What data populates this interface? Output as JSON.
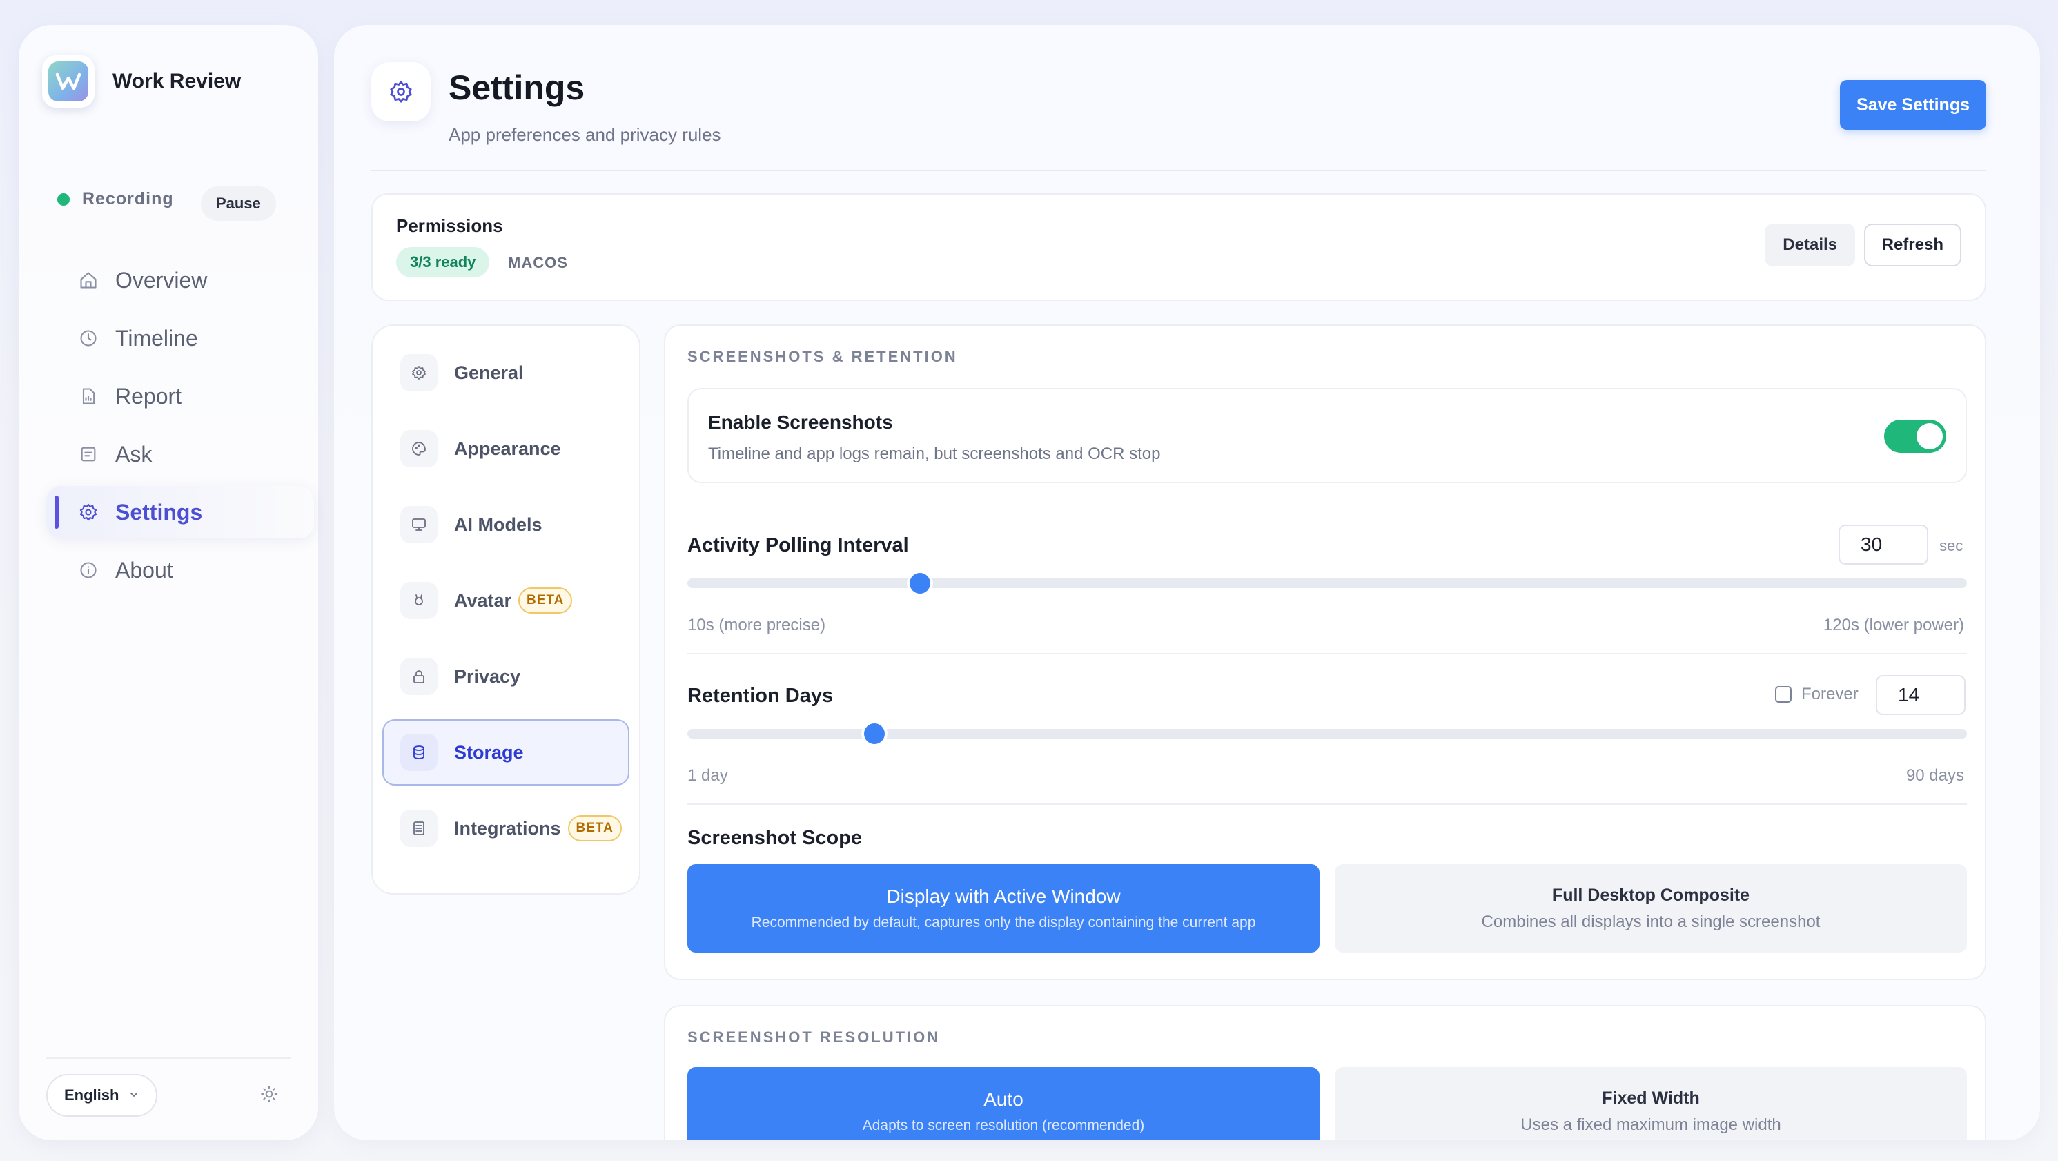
{
  "app": {
    "name": "Work Review"
  },
  "status": {
    "recording_label": "Recording",
    "pause_label": "Pause",
    "recording_color": "#1fb87a"
  },
  "nav": {
    "items": [
      {
        "label": "Overview",
        "icon": "home-icon"
      },
      {
        "label": "Timeline",
        "icon": "clock-icon"
      },
      {
        "label": "Report",
        "icon": "report-icon"
      },
      {
        "label": "Ask",
        "icon": "ask-icon"
      },
      {
        "label": "Settings",
        "icon": "gear-icon",
        "active": true
      },
      {
        "label": "About",
        "icon": "info-icon"
      }
    ]
  },
  "footer": {
    "language": "English"
  },
  "page": {
    "title": "Settings",
    "subtitle": "App preferences and privacy rules",
    "save_label": "Save Settings"
  },
  "permissions": {
    "title": "Permissions",
    "badge": "3/3 ready",
    "os": "MACOS",
    "details_label": "Details",
    "refresh_label": "Refresh"
  },
  "subnav": {
    "items": [
      {
        "label": "General",
        "icon": "gear-icon"
      },
      {
        "label": "Appearance",
        "icon": "palette-icon"
      },
      {
        "label": "AI Models",
        "icon": "monitor-icon"
      },
      {
        "label": "Avatar",
        "icon": "avatar-icon",
        "badge": "BETA"
      },
      {
        "label": "Privacy",
        "icon": "lock-icon"
      },
      {
        "label": "Storage",
        "icon": "database-icon",
        "active": true
      },
      {
        "label": "Integrations",
        "icon": "integrations-icon",
        "badge": "BETA"
      }
    ]
  },
  "screenshots": {
    "section_title": "SCREENSHOTS & RETENTION",
    "enable": {
      "title": "Enable Screenshots",
      "description": "Timeline and app logs remain, but screenshots and OCR stop",
      "on": true
    },
    "polling": {
      "label": "Activity Polling Interval",
      "value": "30",
      "unit": "sec",
      "min_label": "10s (more precise)",
      "max_label": "120s (lower power)",
      "min": 10,
      "max": 120,
      "current": 30
    },
    "retention": {
      "label": "Retention Days",
      "forever_label": "Forever",
      "value": "14",
      "min_label": "1 day",
      "max_label": "90 days",
      "min": 1,
      "max": 90,
      "current": 14
    },
    "scope": {
      "label": "Screenshot Scope",
      "options": [
        {
          "title": "Display with Active Window",
          "description": "Recommended by default, captures only the display containing the current app",
          "selected": true
        },
        {
          "title": "Full Desktop Composite",
          "description": "Combines all displays into a single screenshot",
          "selected": false
        }
      ]
    }
  },
  "resolution": {
    "section_title": "SCREENSHOT RESOLUTION",
    "options": [
      {
        "title": "Auto",
        "description": "Adapts to screen resolution (recommended)",
        "selected": true
      },
      {
        "title": "Fixed Width",
        "description": "Uses a fixed maximum image width",
        "selected": false
      }
    ]
  },
  "colors": {
    "accent": "#3b82f6",
    "brand": "#5b52e0",
    "success": "#1fb87a",
    "beta": "#b26b00"
  }
}
